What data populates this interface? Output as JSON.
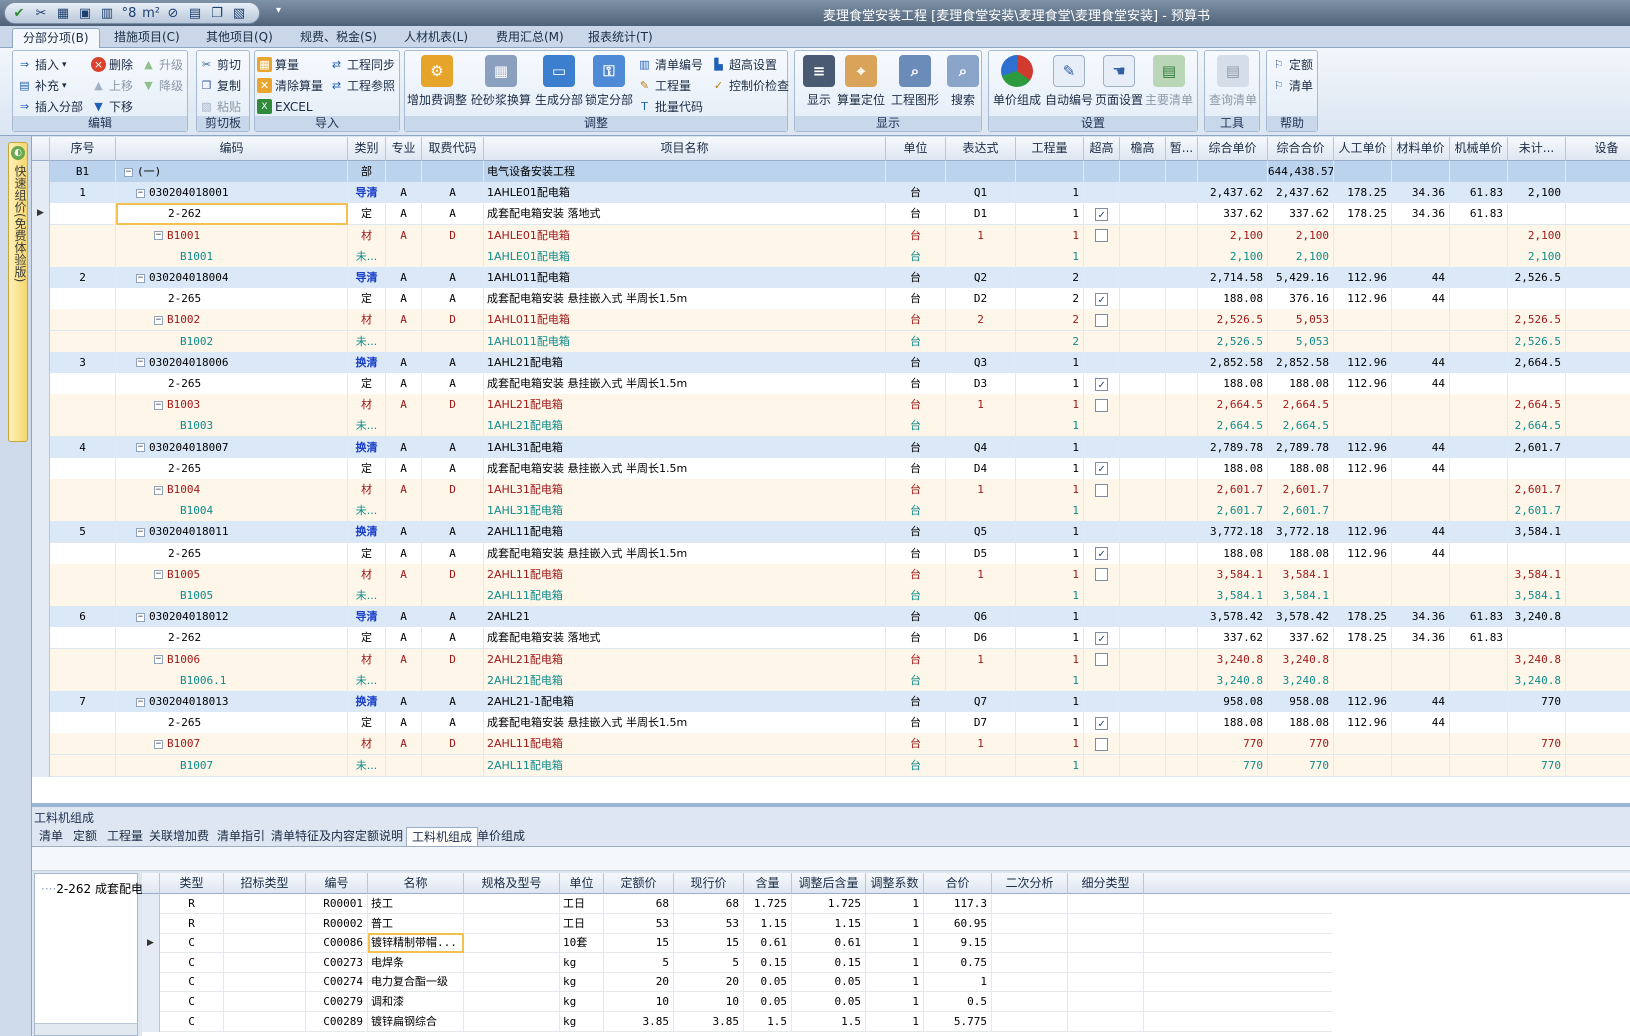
{
  "window": {
    "title": "麦理食堂安装工程 [麦理食堂安装\\麦理食堂\\麦理食堂安装] - 预算书"
  },
  "qat": {
    "items": [
      {
        "name": "confirm-icon",
        "glyph": "✔"
      },
      {
        "name": "scissors-icon",
        "glyph": "✂"
      },
      {
        "name": "table-icon",
        "glyph": "▦"
      },
      {
        "name": "save-icon",
        "glyph": "▣"
      },
      {
        "name": "chart-icon",
        "glyph": "▥"
      },
      {
        "name": "symbol-icon",
        "glyph": "°8"
      },
      {
        "name": "unit-icon",
        "glyph": "m²"
      },
      {
        "name": "calc-icon",
        "glyph": "⊘"
      },
      {
        "name": "doc-icon",
        "glyph": "▤"
      },
      {
        "name": "copy-icon",
        "glyph": "❐"
      },
      {
        "name": "paste-icon",
        "glyph": "▧"
      }
    ],
    "more": "▾"
  },
  "tabs": [
    {
      "label": "分部分项(B)",
      "active": true
    },
    {
      "label": "措施项目(C)",
      "active": false
    },
    {
      "label": "其他项目(Q)",
      "active": false
    },
    {
      "label": "规费、税金(S)",
      "active": false
    },
    {
      "label": "人材机表(L)",
      "active": false
    },
    {
      "label": "费用汇总(M)",
      "active": false
    },
    {
      "label": "报表统计(T)",
      "active": false
    }
  ],
  "ribbon": {
    "edit": {
      "label": "编辑",
      "insert": "插入",
      "delete": "删除",
      "up_level": "升级",
      "supplement": "补充",
      "move_up": "上移",
      "down_level": "降级",
      "insert_part": "插入分部",
      "move_down": "下移"
    },
    "clipboard": {
      "label": "剪切板",
      "cut": "剪切",
      "copy": "复制",
      "paste": "粘贴"
    },
    "import": {
      "label": "导入",
      "calc_qty": "算量",
      "project_sync": "工程同步",
      "clear_calc": "清除算量",
      "project_ref": "工程参照",
      "excel": "EXCEL"
    },
    "adjust": {
      "label": "调整",
      "add_fee": "增加费调整",
      "mortar": "砼砂浆换算",
      "gen_part": "生成分部",
      "lock_part": "锁定分部",
      "list_no": "清单编号",
      "qty": "工程量",
      "batch_code": "批量代码",
      "high_set": "超高设置",
      "price_check": "控制价检查"
    },
    "display": {
      "label": "显示",
      "show": "显示",
      "calc_locate": "算量定位",
      "project_graph": "工程图形",
      "search": "搜索"
    },
    "settings": {
      "label": "设置",
      "unit_price": "单价组成",
      "auto_no": "自动编号",
      "page_set": "页面设置",
      "main_list": "主要清单"
    },
    "tools": {
      "label": "工具",
      "query_list": "查询清单"
    },
    "help": {
      "label": "帮助",
      "quota": "定额",
      "list": "清单"
    }
  },
  "side_panel": {
    "label": "快速组价(免费体验版)"
  },
  "grid": {
    "headers": [
      "序号",
      "编码",
      "类别",
      "专业",
      "取费代码",
      "项目名称",
      "单位",
      "表达式",
      "工程量",
      "超高",
      "檐高",
      "暂...",
      "综合单价",
      "综合合价",
      "人工单价",
      "材料单价",
      "机械单价",
      "未计...",
      "设备"
    ],
    "rows": [
      {
        "type": "part",
        "seq": "B1",
        "code": "(一)",
        "cat": "部",
        "major": "",
        "fee": "",
        "name": "电气设备安装工程",
        "unit": "",
        "expr": "",
        "qty": "",
        "chk": "",
        "up": "",
        "total": "644,438.57",
        "labor": "",
        "mat": "",
        "mach": "",
        "uncounted": ""
      },
      {
        "type": "list",
        "seq": "1",
        "code": "030204018001",
        "cat": "导清",
        "major": "A",
        "fee": "A",
        "name": "1AHLE01配电箱",
        "unit": "台",
        "expr": "Q1",
        "qty": "1",
        "chk": "",
        "up": "2,437.62",
        "total": "2,437.62",
        "labor": "178.25",
        "mat": "34.36",
        "mach": "61.83",
        "uncounted": "2,100"
      },
      {
        "type": "quota",
        "seq": "",
        "code": "2-262",
        "cat": "定",
        "major": "A",
        "fee": "A",
        "name": "成套配电箱安装 落地式",
        "unit": "台",
        "expr": "D1",
        "qty": "1",
        "chk": "on",
        "up": "337.62",
        "total": "337.62",
        "labor": "178.25",
        "mat": "34.36",
        "mach": "61.83",
        "uncounted": ""
      },
      {
        "type": "mat",
        "seq": "",
        "code": "B1001",
        "cat": "材",
        "major": "A",
        "fee": "D",
        "name": "1AHLE01配电箱",
        "unit": "台",
        "expr": "1",
        "qty": "1",
        "chk": "off",
        "up": "2,100",
        "total": "2,100",
        "labor": "",
        "mat": "",
        "mach": "",
        "uncounted": "2,100"
      },
      {
        "type": "unc",
        "seq": "",
        "code": "B1001",
        "cat": "未...",
        "major": "",
        "fee": "",
        "name": "1AHLE01配电箱",
        "unit": "台",
        "expr": "",
        "qty": "1",
        "chk": "",
        "up": "2,100",
        "total": "2,100",
        "labor": "",
        "mat": "",
        "mach": "",
        "uncounted": "2,100"
      },
      {
        "type": "list",
        "seq": "2",
        "code": "030204018004",
        "cat": "导清",
        "major": "A",
        "fee": "A",
        "name": "1AHL011配电箱",
        "unit": "台",
        "expr": "Q2",
        "qty": "2",
        "chk": "",
        "up": "2,714.58",
        "total": "5,429.16",
        "labor": "112.96",
        "mat": "44",
        "mach": "",
        "uncounted": "2,526.5"
      },
      {
        "type": "quota",
        "seq": "",
        "code": "2-265",
        "cat": "定",
        "major": "A",
        "fee": "A",
        "name": "成套配电箱安装 悬挂嵌入式 半周长1.5m",
        "unit": "台",
        "expr": "D2",
        "qty": "2",
        "chk": "on",
        "up": "188.08",
        "total": "376.16",
        "labor": "112.96",
        "mat": "44",
        "mach": "",
        "uncounted": ""
      },
      {
        "type": "mat",
        "seq": "",
        "code": "B1002",
        "cat": "材",
        "major": "A",
        "fee": "D",
        "name": "1AHL011配电箱",
        "unit": "台",
        "expr": "2",
        "qty": "2",
        "chk": "off",
        "up": "2,526.5",
        "total": "5,053",
        "labor": "",
        "mat": "",
        "mach": "",
        "uncounted": "2,526.5"
      },
      {
        "type": "unc",
        "seq": "",
        "code": "B1002",
        "cat": "未...",
        "major": "",
        "fee": "",
        "name": "1AHL011配电箱",
        "unit": "台",
        "expr": "",
        "qty": "2",
        "chk": "",
        "up": "2,526.5",
        "total": "5,053",
        "labor": "",
        "mat": "",
        "mach": "",
        "uncounted": "2,526.5"
      },
      {
        "type": "list",
        "seq": "3",
        "code": "030204018006",
        "cat": "换清",
        "major": "A",
        "fee": "A",
        "name": "1AHL21配电箱",
        "unit": "台",
        "expr": "Q3",
        "qty": "1",
        "chk": "",
        "up": "2,852.58",
        "total": "2,852.58",
        "labor": "112.96",
        "mat": "44",
        "mach": "",
        "uncounted": "2,664.5"
      },
      {
        "type": "quota",
        "seq": "",
        "code": "2-265",
        "cat": "定",
        "major": "A",
        "fee": "A",
        "name": "成套配电箱安装 悬挂嵌入式 半周长1.5m",
        "unit": "台",
        "expr": "D3",
        "qty": "1",
        "chk": "on",
        "up": "188.08",
        "total": "188.08",
        "labor": "112.96",
        "mat": "44",
        "mach": "",
        "uncounted": ""
      },
      {
        "type": "mat",
        "seq": "",
        "code": "B1003",
        "cat": "材",
        "major": "A",
        "fee": "D",
        "name": "1AHL21配电箱",
        "unit": "台",
        "expr": "1",
        "qty": "1",
        "chk": "off",
        "up": "2,664.5",
        "total": "2,664.5",
        "labor": "",
        "mat": "",
        "mach": "",
        "uncounted": "2,664.5"
      },
      {
        "type": "unc",
        "seq": "",
        "code": "B1003",
        "cat": "未...",
        "major": "",
        "fee": "",
        "name": "1AHL21配电箱",
        "unit": "台",
        "expr": "",
        "qty": "1",
        "chk": "",
        "up": "2,664.5",
        "total": "2,664.5",
        "labor": "",
        "mat": "",
        "mach": "",
        "uncounted": "2,664.5"
      },
      {
        "type": "list",
        "seq": "4",
        "code": "030204018007",
        "cat": "换清",
        "major": "A",
        "fee": "A",
        "name": "1AHL31配电箱",
        "unit": "台",
        "expr": "Q4",
        "qty": "1",
        "chk": "",
        "up": "2,789.78",
        "total": "2,789.78",
        "labor": "112.96",
        "mat": "44",
        "mach": "",
        "uncounted": "2,601.7"
      },
      {
        "type": "quota",
        "seq": "",
        "code": "2-265",
        "cat": "定",
        "major": "A",
        "fee": "A",
        "name": "成套配电箱安装 悬挂嵌入式 半周长1.5m",
        "unit": "台",
        "expr": "D4",
        "qty": "1",
        "chk": "on",
        "up": "188.08",
        "total": "188.08",
        "labor": "112.96",
        "mat": "44",
        "mach": "",
        "uncounted": ""
      },
      {
        "type": "mat",
        "seq": "",
        "code": "B1004",
        "cat": "材",
        "major": "A",
        "fee": "D",
        "name": "1AHL31配电箱",
        "unit": "台",
        "expr": "1",
        "qty": "1",
        "chk": "off",
        "up": "2,601.7",
        "total": "2,601.7",
        "labor": "",
        "mat": "",
        "mach": "",
        "uncounted": "2,601.7"
      },
      {
        "type": "unc",
        "seq": "",
        "code": "B1004",
        "cat": "未...",
        "major": "",
        "fee": "",
        "name": "1AHL31配电箱",
        "unit": "台",
        "expr": "",
        "qty": "1",
        "chk": "",
        "up": "2,601.7",
        "total": "2,601.7",
        "labor": "",
        "mat": "",
        "mach": "",
        "uncounted": "2,601.7"
      },
      {
        "type": "list",
        "seq": "5",
        "code": "030204018011",
        "cat": "换清",
        "major": "A",
        "fee": "A",
        "name": "2AHL11配电箱",
        "unit": "台",
        "expr": "Q5",
        "qty": "1",
        "chk": "",
        "up": "3,772.18",
        "total": "3,772.18",
        "labor": "112.96",
        "mat": "44",
        "mach": "",
        "uncounted": "3,584.1"
      },
      {
        "type": "quota",
        "seq": "",
        "code": "2-265",
        "cat": "定",
        "major": "A",
        "fee": "A",
        "name": "成套配电箱安装 悬挂嵌入式 半周长1.5m",
        "unit": "台",
        "expr": "D5",
        "qty": "1",
        "chk": "on",
        "up": "188.08",
        "total": "188.08",
        "labor": "112.96",
        "mat": "44",
        "mach": "",
        "uncounted": ""
      },
      {
        "type": "mat",
        "seq": "",
        "code": "B1005",
        "cat": "材",
        "major": "A",
        "fee": "D",
        "name": "2AHL11配电箱",
        "unit": "台",
        "expr": "1",
        "qty": "1",
        "chk": "off",
        "up": "3,584.1",
        "total": "3,584.1",
        "labor": "",
        "mat": "",
        "mach": "",
        "uncounted": "3,584.1"
      },
      {
        "type": "unc",
        "seq": "",
        "code": "B1005",
        "cat": "未...",
        "major": "",
        "fee": "",
        "name": "2AHL11配电箱",
        "unit": "台",
        "expr": "",
        "qty": "1",
        "chk": "",
        "up": "3,584.1",
        "total": "3,584.1",
        "labor": "",
        "mat": "",
        "mach": "",
        "uncounted": "3,584.1"
      },
      {
        "type": "list",
        "seq": "6",
        "code": "030204018012",
        "cat": "导清",
        "major": "A",
        "fee": "A",
        "name": "2AHL21",
        "unit": "台",
        "expr": "Q6",
        "qty": "1",
        "chk": "",
        "up": "3,578.42",
        "total": "3,578.42",
        "labor": "178.25",
        "mat": "34.36",
        "mach": "61.83",
        "uncounted": "3,240.8"
      },
      {
        "type": "quota",
        "seq": "",
        "code": "2-262",
        "cat": "定",
        "major": "A",
        "fee": "A",
        "name": "成套配电箱安装 落地式",
        "unit": "台",
        "expr": "D6",
        "qty": "1",
        "chk": "on",
        "up": "337.62",
        "total": "337.62",
        "labor": "178.25",
        "mat": "34.36",
        "mach": "61.83",
        "uncounted": ""
      },
      {
        "type": "mat",
        "seq": "",
        "code": "B1006",
        "cat": "材",
        "major": "A",
        "fee": "D",
        "name": "2AHL21配电箱",
        "unit": "台",
        "expr": "1",
        "qty": "1",
        "chk": "off",
        "up": "3,240.8",
        "total": "3,240.8",
        "labor": "",
        "mat": "",
        "mach": "",
        "uncounted": "3,240.8"
      },
      {
        "type": "unc",
        "seq": "",
        "code": "B1006.1",
        "cat": "未...",
        "major": "",
        "fee": "",
        "name": "2AHL21配电箱",
        "unit": "台",
        "expr": "",
        "qty": "1",
        "chk": "",
        "up": "3,240.8",
        "total": "3,240.8",
        "labor": "",
        "mat": "",
        "mach": "",
        "uncounted": "3,240.8"
      },
      {
        "type": "list",
        "seq": "7",
        "code": "030204018013",
        "cat": "换清",
        "major": "A",
        "fee": "A",
        "name": "2AHL21-1配电箱",
        "unit": "台",
        "expr": "Q7",
        "qty": "1",
        "chk": "",
        "up": "958.08",
        "total": "958.08",
        "labor": "112.96",
        "mat": "44",
        "mach": "",
        "uncounted": "770"
      },
      {
        "type": "quota",
        "seq": "",
        "code": "2-265",
        "cat": "定",
        "major": "A",
        "fee": "A",
        "name": "成套配电箱安装 悬挂嵌入式 半周长1.5m",
        "unit": "台",
        "expr": "D7",
        "qty": "1",
        "chk": "on",
        "up": "188.08",
        "total": "188.08",
        "labor": "112.96",
        "mat": "44",
        "mach": "",
        "uncounted": ""
      },
      {
        "type": "mat",
        "seq": "",
        "code": "B1007",
        "cat": "材",
        "major": "A",
        "fee": "D",
        "name": "2AHL11配电箱",
        "unit": "台",
        "expr": "1",
        "qty": "1",
        "chk": "off",
        "up": "770",
        "total": "770",
        "labor": "",
        "mat": "",
        "mach": "",
        "uncounted": "770"
      },
      {
        "type": "unc",
        "seq": "",
        "code": "B1007",
        "cat": "未...",
        "major": "",
        "fee": "",
        "name": "2AHL11配电箱",
        "unit": "台",
        "expr": "",
        "qty": "1",
        "chk": "",
        "up": "770",
        "total": "770",
        "labor": "",
        "mat": "",
        "mach": "",
        "uncounted": "770"
      }
    ]
  },
  "bottom": {
    "title": "工料机组成",
    "tabs": [
      {
        "label": "清单",
        "active": false
      },
      {
        "label": "定额",
        "active": false
      },
      {
        "label": "工程量",
        "active": false
      },
      {
        "label": "关联增加费",
        "active": false
      },
      {
        "label": "清单指引",
        "active": false
      },
      {
        "label": "清单特征及内容",
        "active": false
      },
      {
        "label": "定额说明",
        "active": false
      },
      {
        "label": "工料机组成",
        "active": true
      },
      {
        "label": "单价组成",
        "active": false
      }
    ],
    "tree_item": "2-262 成套配电",
    "headers": [
      "类型",
      "招标类型",
      "编号",
      "名称",
      "规格及型号",
      "单位",
      "定额价",
      "现行价",
      "含量",
      "调整后含量",
      "调整系数",
      "合价",
      "二次分析",
      "细分类型"
    ],
    "rows": [
      {
        "type": "R",
        "bid": "",
        "code": "R00001",
        "name": "技工",
        "spec": "",
        "unit": "工日",
        "quota": "68",
        "current": "68",
        "content": "1.725",
        "adj": "1.725",
        "coef": "1",
        "total": "117.3"
      },
      {
        "type": "R",
        "bid": "",
        "code": "R00002",
        "name": "普工",
        "spec": "",
        "unit": "工日",
        "quota": "53",
        "current": "53",
        "content": "1.15",
        "adj": "1.15",
        "coef": "1",
        "total": "60.95"
      },
      {
        "type": "C",
        "bid": "",
        "code": "C00086",
        "name": "镀锌精制带帽...",
        "spec": "",
        "unit": "10套",
        "quota": "15",
        "current": "15",
        "content": "0.61",
        "adj": "0.61",
        "coef": "1",
        "total": "9.15"
      },
      {
        "type": "C",
        "bid": "",
        "code": "C00273",
        "name": "电焊条",
        "spec": "",
        "unit": "kg",
        "quota": "5",
        "current": "5",
        "content": "0.15",
        "adj": "0.15",
        "coef": "1",
        "total": "0.75"
      },
      {
        "type": "C",
        "bid": "",
        "code": "C00274",
        "name": "电力复合酯一级",
        "spec": "",
        "unit": "kg",
        "quota": "20",
        "current": "20",
        "content": "0.05",
        "adj": "0.05",
        "coef": "1",
        "total": "1"
      },
      {
        "type": "C",
        "bid": "",
        "code": "C00279",
        "name": "调和漆",
        "spec": "",
        "unit": "kg",
        "quota": "10",
        "current": "10",
        "content": "0.05",
        "adj": "0.05",
        "coef": "1",
        "total": "0.5"
      },
      {
        "type": "C",
        "bid": "",
        "code": "C00289",
        "name": "镀锌扁钢综合",
        "spec": "",
        "unit": "kg",
        "quota": "3.85",
        "current": "3.85",
        "content": "1.5",
        "adj": "1.5",
        "coef": "1",
        "total": "5.775"
      }
    ]
  },
  "colors": {
    "part_row": "#bcd3ee",
    "list_row": "#dbe8f7",
    "mat_row": "#fdf6e9",
    "mat_text": "#a01818",
    "unc_text": "#0f8a8a",
    "list_cat": "#1a3fc8"
  }
}
